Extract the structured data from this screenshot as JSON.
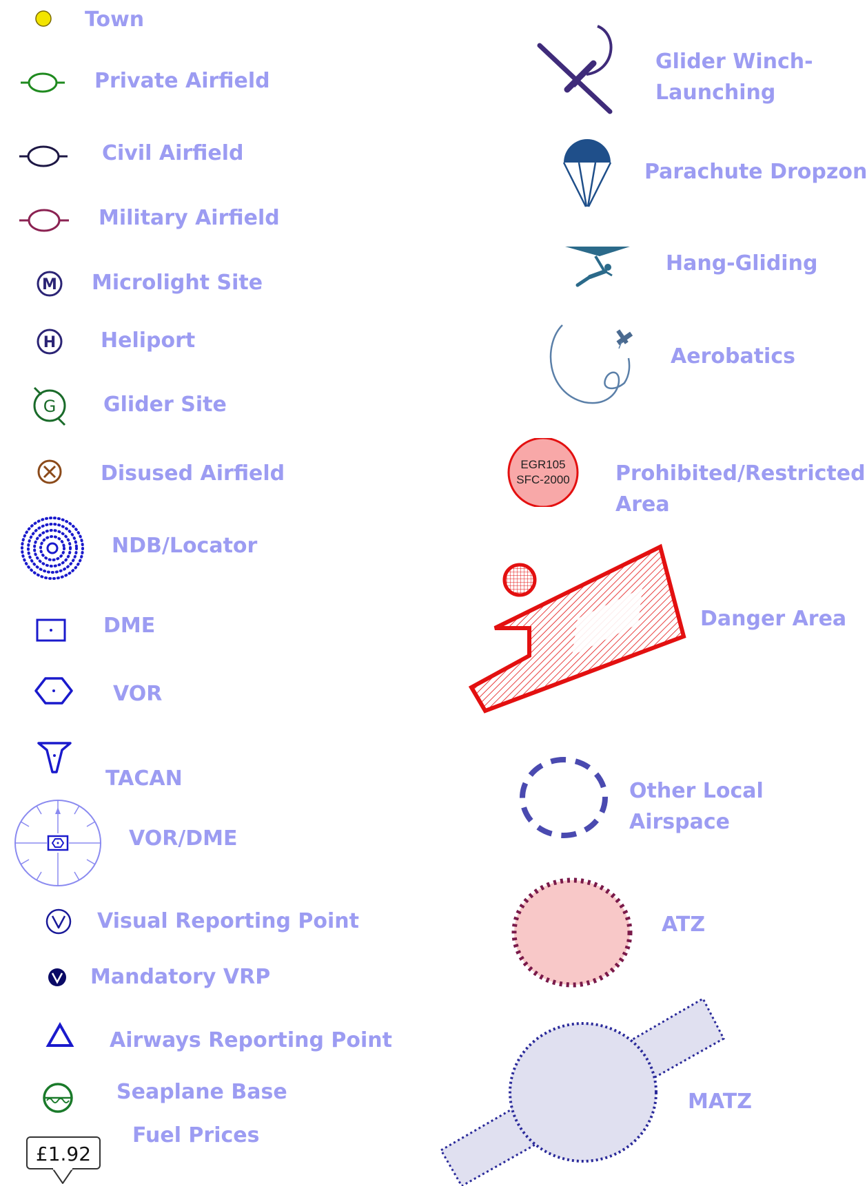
{
  "legend_left": [
    {
      "id": "town",
      "label": "Town",
      "icon": "town-icon",
      "color": "#f2e400"
    },
    {
      "id": "private-airfield",
      "label": "Private Airfield",
      "icon": "private-airfield-icon",
      "color": "#1f8a1f"
    },
    {
      "id": "civil-airfield",
      "label": "Civil Airfield",
      "icon": "civil-airfield-icon",
      "color": "#1d1744"
    },
    {
      "id": "military-airfield",
      "label": "Military Airfield",
      "icon": "military-airfield-icon",
      "color": "#8b2252"
    },
    {
      "id": "microlight-site",
      "label": "Microlight Site",
      "icon": "microlight-icon",
      "color": "#2b2475"
    },
    {
      "id": "heliport",
      "label": "Heliport",
      "icon": "heliport-icon",
      "color": "#2b2475"
    },
    {
      "id": "glider-site",
      "label": "Glider Site",
      "icon": "glider-site-icon",
      "color": "#1a6b2a"
    },
    {
      "id": "disused-airfield",
      "label": "Disused Airfield",
      "icon": "disused-airfield-icon",
      "color": "#8b4a1a"
    },
    {
      "id": "ndb-locator",
      "label": "NDB/Locator",
      "icon": "ndb-icon",
      "color": "#1a1acc"
    },
    {
      "id": "dme",
      "label": "DME",
      "icon": "dme-icon",
      "color": "#1a1acc"
    },
    {
      "id": "vor",
      "label": "VOR",
      "icon": "vor-icon",
      "color": "#1a1acc"
    },
    {
      "id": "tacan",
      "label": "TACAN",
      "icon": "tacan-icon",
      "color": "#1a1acc"
    },
    {
      "id": "vor-dme",
      "label": "VOR/DME",
      "icon": "vor-dme-icon",
      "color": "#8a8af0"
    },
    {
      "id": "visual-reporting-point",
      "label": "Visual Reporting Point",
      "icon": "vrp-icon",
      "color": "#1a1a99"
    },
    {
      "id": "mandatory-vrp",
      "label": "Mandatory VRP",
      "icon": "mandatory-vrp-icon",
      "color": "#0a0a66"
    },
    {
      "id": "airways-reporting-point",
      "label": "Airways Reporting Point",
      "icon": "airways-reporting-point-icon",
      "color": "#1a1acc"
    },
    {
      "id": "seaplane-base",
      "label": "Seaplane Base",
      "icon": "seaplane-icon",
      "color": "#1a7a2a"
    },
    {
      "id": "fuel-prices",
      "label": "Fuel Prices",
      "icon": "fuel-price-badge",
      "badge_text": "£1.92"
    }
  ],
  "legend_right": [
    {
      "id": "glider-winch",
      "label_lines": [
        "Glider Winch-",
        "Launching"
      ],
      "icon": "glider-winch-icon",
      "color": "#3f2b7a"
    },
    {
      "id": "parachute",
      "label": "Parachute Dropzone",
      "icon": "parachute-icon",
      "color": "#1f4f8a"
    },
    {
      "id": "hang-gliding",
      "label": "Hang-Gliding",
      "icon": "hang-glider-icon",
      "color": "#2b6a8a"
    },
    {
      "id": "aerobatics",
      "label": "Aerobatics",
      "icon": "aerobatics-icon",
      "color": "#5a7fa8"
    },
    {
      "id": "prohibited-restricted",
      "label_lines": [
        "Prohibited/Restricted",
        "Area"
      ],
      "icon": "restricted-area-icon",
      "color": "#e31010",
      "badge_lines": [
        "EGR105",
        "SFC-2000"
      ]
    },
    {
      "id": "danger-area",
      "label": "Danger Area",
      "icon": "danger-area-icon",
      "color": "#e31010"
    },
    {
      "id": "other-local-airspace",
      "label_lines": [
        "Other Local",
        "Airspace"
      ],
      "icon": "local-airspace-icon",
      "color": "#4a4ab0"
    },
    {
      "id": "atz",
      "label": "ATZ",
      "icon": "atz-icon",
      "color": "#7a1a4a"
    },
    {
      "id": "matz",
      "label": "MATZ",
      "icon": "matz-icon",
      "color": "#2a2a9a"
    }
  ]
}
